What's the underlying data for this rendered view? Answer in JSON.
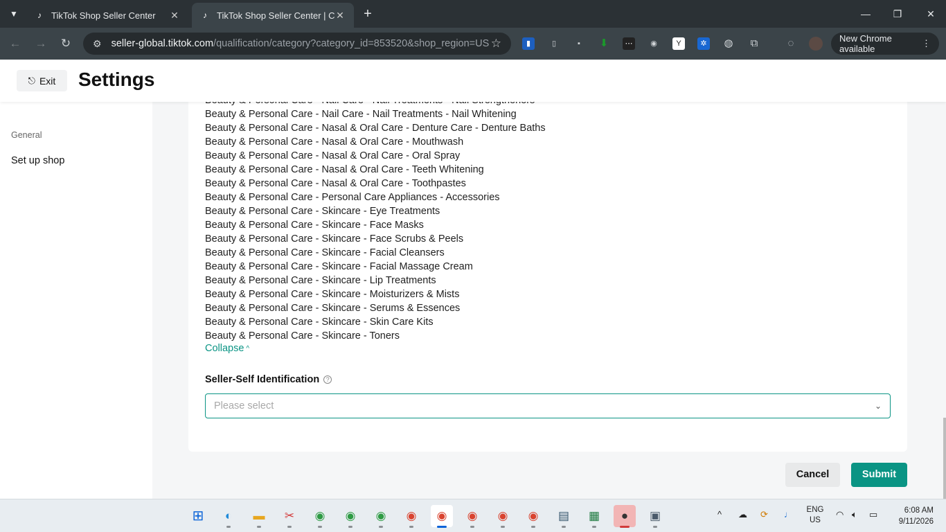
{
  "browser": {
    "tabs": [
      {
        "title": "TikTok Shop Seller Center",
        "active": false
      },
      {
        "title": "TikTok Shop Seller Center | Cros",
        "active": true
      }
    ],
    "new_tab_icon": "plus-icon",
    "url_host": "seller-global.tiktok.com",
    "url_path": "/qualification/category?category_id=853520&shop_region=US",
    "new_chrome_label": "New Chrome available"
  },
  "header": {
    "exit_label": "Exit",
    "title": "Settings"
  },
  "sidebar": {
    "section_label": "General",
    "items": [
      {
        "label": "Set up shop"
      }
    ]
  },
  "categories": [
    "Beauty & Personal Care - Nail Care - Nail Treatments - Nail Strengtheners",
    "Beauty & Personal Care - Nail Care - Nail Treatments - Nail Whitening",
    "Beauty & Personal Care - Nasal & Oral Care - Denture Care - Denture Baths",
    "Beauty & Personal Care - Nasal & Oral Care - Mouthwash",
    "Beauty & Personal Care - Nasal & Oral Care - Oral Spray",
    "Beauty & Personal Care - Nasal & Oral Care - Teeth Whitening",
    "Beauty & Personal Care - Nasal & Oral Care - Toothpastes",
    "Beauty & Personal Care - Personal Care Appliances - Accessories",
    "Beauty & Personal Care - Skincare - Eye Treatments",
    "Beauty & Personal Care - Skincare - Face Masks",
    "Beauty & Personal Care - Skincare - Face Scrubs & Peels",
    "Beauty & Personal Care - Skincare - Facial Cleansers",
    "Beauty & Personal Care - Skincare - Facial Massage Cream",
    "Beauty & Personal Care - Skincare - Lip Treatments",
    "Beauty & Personal Care - Skincare - Moisturizers & Mists",
    "Beauty & Personal Care - Skincare - Serums & Essences",
    "Beauty & Personal Care - Skincare - Skin Care Kits",
    "Beauty & Personal Care - Skincare - Toners"
  ],
  "collapse_label": "Collapse",
  "seller_identification": {
    "label": "Seller-Self Identification",
    "placeholder": "Please select"
  },
  "actions": {
    "cancel_label": "Cancel",
    "submit_label": "Submit"
  },
  "colors": {
    "accent": "#0a9484",
    "chrome_dark": "#2b3135",
    "page_bg": "#f5f6f7"
  },
  "taskbar": {
    "apps": [
      "windows-start-icon",
      "edge-icon",
      "file-explorer-icon",
      "snipping-tool-icon",
      "chrome-icon",
      "chrome-icon",
      "chrome-icon",
      "chrome-icon",
      "chrome-icon",
      "chrome-icon",
      "chrome-icon",
      "chrome-icon",
      "terminal-icon",
      "excel-icon",
      "chat-icon",
      "calculator-icon"
    ],
    "lang_line1": "ENG",
    "lang_line2": "US",
    "time": "6:08 AM",
    "date": "9/11/2026"
  }
}
